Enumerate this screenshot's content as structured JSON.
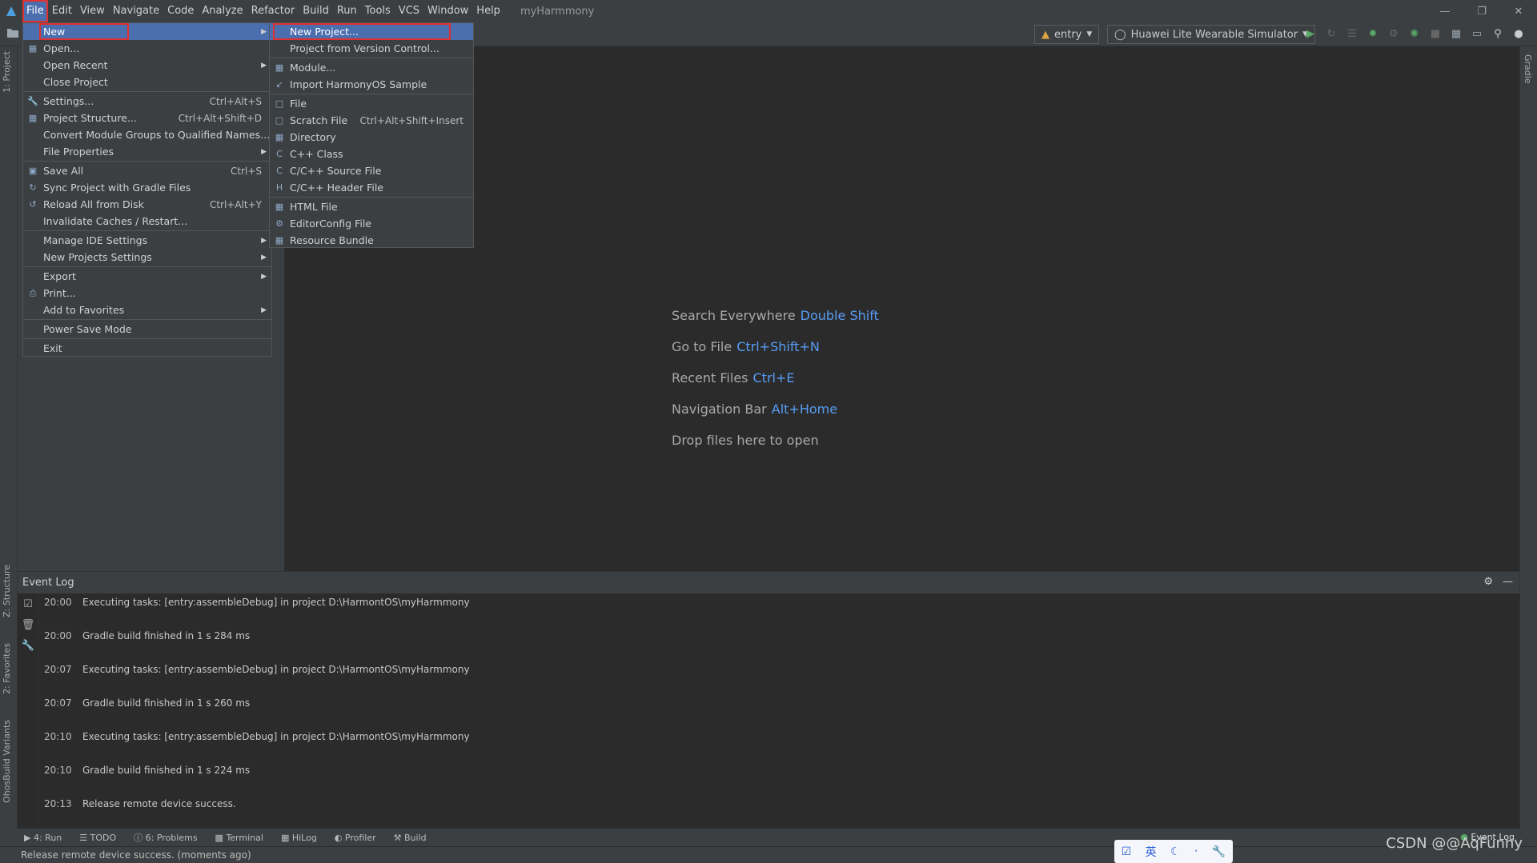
{
  "menubar": {
    "items": [
      "File",
      "Edit",
      "View",
      "Navigate",
      "Code",
      "Analyze",
      "Refactor",
      "Build",
      "Run",
      "Tools",
      "VCS",
      "Window",
      "Help"
    ],
    "project_title": "myHarmmony"
  },
  "toolbar": {
    "run_config": "entry",
    "device": "Huawei Lite Wearable Simulator"
  },
  "left_stripe": {
    "project_tab": "1: Project",
    "structure_tab": "Z: Structure",
    "favorites_tab": "2: Favorites",
    "build_variants_tab": "OhosBuild Variants"
  },
  "right_stripe": {
    "gradle_tab": "Gradle"
  },
  "file_menu": {
    "items": [
      {
        "label": "New",
        "shortcut": "",
        "submenu": true
      },
      {
        "label": "Open...",
        "shortcut": "",
        "submenu": false
      },
      {
        "label": "Open Recent",
        "shortcut": "",
        "submenu": true
      },
      {
        "label": "Close Project",
        "shortcut": "",
        "submenu": false
      },
      {
        "label": "Settings...",
        "shortcut": "Ctrl+Alt+S",
        "submenu": false
      },
      {
        "label": "Project Structure...",
        "shortcut": "Ctrl+Alt+Shift+D",
        "submenu": false
      },
      {
        "label": "Convert Module Groups to Qualified Names...",
        "shortcut": "",
        "submenu": false
      },
      {
        "label": "File Properties",
        "shortcut": "",
        "submenu": true
      },
      {
        "label": "Save All",
        "shortcut": "Ctrl+S",
        "submenu": false
      },
      {
        "label": "Sync Project with Gradle Files",
        "shortcut": "",
        "submenu": false
      },
      {
        "label": "Reload All from Disk",
        "shortcut": "Ctrl+Alt+Y",
        "submenu": false
      },
      {
        "label": "Invalidate Caches / Restart...",
        "shortcut": "",
        "submenu": false
      },
      {
        "label": "Manage IDE Settings",
        "shortcut": "",
        "submenu": true
      },
      {
        "label": "New Projects Settings",
        "shortcut": "",
        "submenu": true
      },
      {
        "label": "Export",
        "shortcut": "",
        "submenu": true
      },
      {
        "label": "Print...",
        "shortcut": "",
        "submenu": false
      },
      {
        "label": "Add to Favorites",
        "shortcut": "",
        "submenu": true
      },
      {
        "label": "Power Save Mode",
        "shortcut": "",
        "submenu": false
      },
      {
        "label": "Exit",
        "shortcut": "",
        "submenu": false
      }
    ]
  },
  "new_submenu": {
    "items": [
      {
        "label": "New Project...",
        "shortcut": ""
      },
      {
        "label": "Project from Version Control...",
        "shortcut": ""
      },
      {
        "label": "Module...",
        "shortcut": ""
      },
      {
        "label": "Import HarmonyOS Sample",
        "shortcut": ""
      },
      {
        "label": "File",
        "shortcut": ""
      },
      {
        "label": "Scratch File",
        "shortcut": "Ctrl+Alt+Shift+Insert"
      },
      {
        "label": "Directory",
        "shortcut": ""
      },
      {
        "label": "C++ Class",
        "shortcut": ""
      },
      {
        "label": "C/C++ Source File",
        "shortcut": ""
      },
      {
        "label": "C/C++ Header File",
        "shortcut": ""
      },
      {
        "label": "HTML File",
        "shortcut": ""
      },
      {
        "label": "EditorConfig File",
        "shortcut": ""
      },
      {
        "label": "Resource Bundle",
        "shortcut": ""
      }
    ]
  },
  "hints": [
    {
      "text": "Search Everywhere",
      "key": "Double Shift"
    },
    {
      "text": "Go to File",
      "key": "Ctrl+Shift+N"
    },
    {
      "text": "Recent Files",
      "key": "Ctrl+E"
    },
    {
      "text": "Navigation Bar",
      "key": "Alt+Home"
    },
    {
      "text": "Drop files here to open",
      "key": ""
    }
  ],
  "event_log": {
    "title": "Event Log",
    "entries": [
      {
        "time": "20:00",
        "message": "Executing tasks: [entry:assembleDebug] in project D:\\HarmontOS\\myHarmmony"
      },
      {
        "time": "20:00",
        "message": "Gradle build finished in 1 s 284 ms"
      },
      {
        "time": "20:07",
        "message": "Executing tasks: [entry:assembleDebug] in project D:\\HarmontOS\\myHarmmony"
      },
      {
        "time": "20:07",
        "message": "Gradle build finished in 1 s 260 ms"
      },
      {
        "time": "20:10",
        "message": "Executing tasks: [entry:assembleDebug] in project D:\\HarmontOS\\myHarmmony"
      },
      {
        "time": "20:10",
        "message": "Gradle build finished in 1 s 224 ms"
      },
      {
        "time": "20:13",
        "message": "Release remote device success."
      }
    ]
  },
  "bottom_tabs": [
    "4: Run",
    "TODO",
    "6: Problems",
    "Terminal",
    "HiLog",
    "Profiler",
    "Build"
  ],
  "status": {
    "message": "Release remote device success. (moments ago)",
    "event_log_badge": "Event Log",
    "watermark": "CSDN @@AqFunny",
    "ime": "英"
  }
}
